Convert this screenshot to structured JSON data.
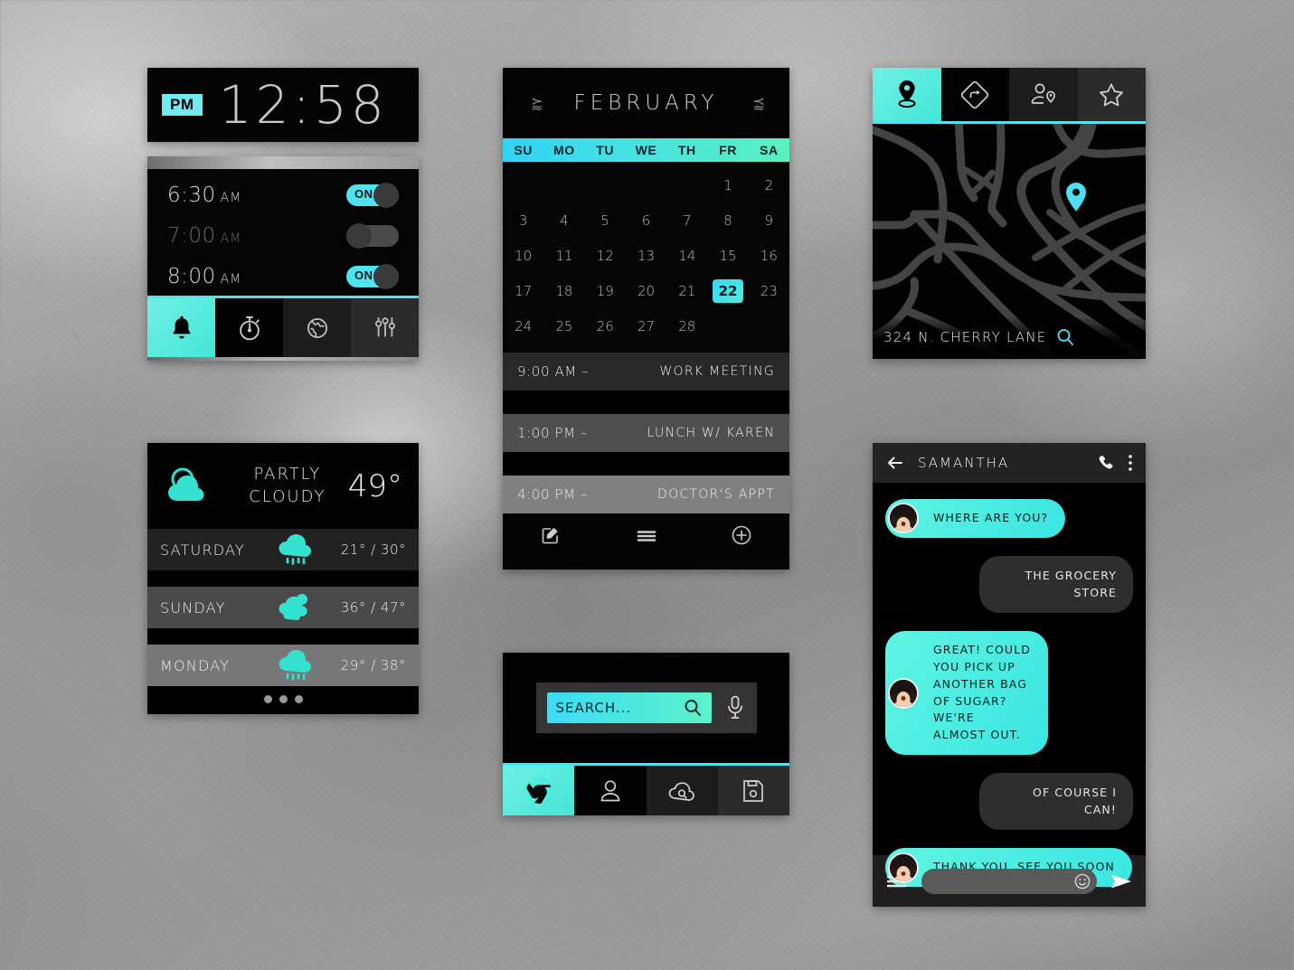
{
  "clock": {
    "meridiem_badge": "PM",
    "time": "12:58",
    "accent": "#6feaf0"
  },
  "alarm": {
    "alarms": [
      {
        "time": "6:30",
        "ampm": "AM",
        "enabled": true,
        "toggle_label": "ON"
      },
      {
        "time": "7:00",
        "ampm": "AM",
        "enabled": false,
        "toggle_label": ""
      },
      {
        "time": "8:00",
        "ampm": "AM",
        "enabled": true,
        "toggle_label": "ON"
      }
    ],
    "nav": [
      {
        "icon": "bell-icon",
        "active": true
      },
      {
        "icon": "stopwatch-icon",
        "active": false
      },
      {
        "icon": "globe-icon",
        "active": false
      },
      {
        "icon": "sliders-icon",
        "active": false
      }
    ],
    "accent": "#4fe3ef"
  },
  "weather": {
    "condition": "PARTLY CLOUDY",
    "condition_line1": "PARTLY",
    "condition_line2": "CLOUDY",
    "current_temp": "49°",
    "current_icon": "sun-behind-cloud-icon",
    "forecast": [
      {
        "day": "SATURDAY",
        "icon": "rain-cloud-icon",
        "range": "21° / 30°"
      },
      {
        "day": "SUNDAY",
        "icon": "partly-cloudy-icon",
        "range": "36° / 47°"
      },
      {
        "day": "MONDAY",
        "icon": "rain-cloud-icon",
        "range": "29° / 38°"
      }
    ],
    "pager_dots": 3,
    "accent": "#3ce0cf"
  },
  "calendar": {
    "month": "FEBRUARY",
    "prev_arrow": "⪸",
    "next_arrow": "⪷",
    "dow": [
      "SU",
      "MO",
      "TU",
      "WE",
      "TH",
      "FR",
      "SA"
    ],
    "weeks": [
      [
        "",
        "",
        "",
        "",
        "",
        "1",
        "2"
      ],
      [
        "3",
        "4",
        "5",
        "6",
        "7",
        "8",
        "9"
      ],
      [
        "10",
        "11",
        "12",
        "13",
        "14",
        "15",
        "16"
      ],
      [
        "17",
        "18",
        "19",
        "20",
        "21",
        "22",
        "23"
      ],
      [
        "24",
        "25",
        "26",
        "27",
        "28",
        "",
        ""
      ]
    ],
    "selected_day": "22",
    "events": [
      {
        "time": "9:00 AM –",
        "title": "WORK MEETING"
      },
      {
        "time": "1:00 PM –",
        "title": "LUNCH W/ KAREN"
      },
      {
        "time": "4:00 PM –",
        "title": "DOCTOR'S APPT"
      }
    ],
    "footer_icons": [
      "compose-icon",
      "list-icon",
      "add-circle-icon"
    ],
    "header_gradient_from": "#2fd4f5",
    "header_gradient_to": "#5bf0bf"
  },
  "search": {
    "placeholder": "SEARCH...",
    "search_icon": "magnifier-icon",
    "mic_icon": "microphone-icon",
    "nav": [
      {
        "icon": "chrome-icon",
        "active": true
      },
      {
        "icon": "person-icon",
        "active": false
      },
      {
        "icon": "cloud-search-icon",
        "active": false
      },
      {
        "icon": "save-disk-icon",
        "active": false
      }
    ],
    "accent": "#4fe3ef"
  },
  "map": {
    "tabs": [
      {
        "icon": "location-pin-icon",
        "active": true
      },
      {
        "icon": "directions-icon",
        "active": false
      },
      {
        "icon": "nearby-person-icon",
        "active": false
      },
      {
        "icon": "star-icon",
        "active": false
      }
    ],
    "address": "324 N. CHERRY LANE",
    "search_icon": "magnifier-icon",
    "pin_color": "#4de0f5",
    "road_color": "#444444"
  },
  "chat": {
    "contact": "SAMANTHA",
    "back_icon": "arrow-left-icon",
    "call_icon": "phone-icon",
    "menu_icon": "more-vertical-icon",
    "messages": [
      {
        "from": "them",
        "text": "WHERE ARE YOU?"
      },
      {
        "from": "me",
        "text": "THE GROCERY STORE"
      },
      {
        "from": "them",
        "text": "GREAT!  COULD YOU PICK UP ANOTHER BAG OF SUGAR? WE'RE ALMOST OUT."
      },
      {
        "from": "me",
        "text": "OF COURSE I CAN!"
      },
      {
        "from": "them",
        "text": "THANK YOU, SEE YOU SOON"
      }
    ],
    "footer": {
      "menu_icon": "hamburger-icon",
      "emoji_icon": "smiley-icon",
      "send_icon": "send-icon",
      "input_value": ""
    },
    "bubble_accent": "#4ceede"
  }
}
